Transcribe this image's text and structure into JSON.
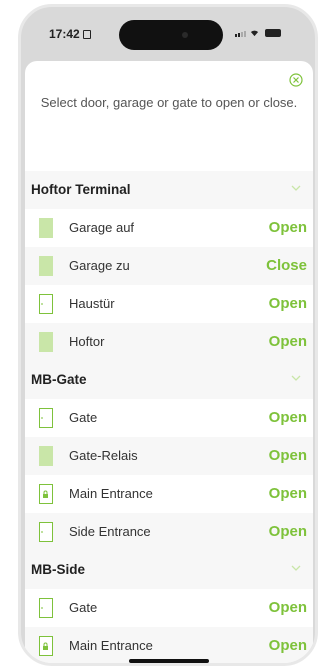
{
  "status_bar": {
    "time": "17:42"
  },
  "intro_text": "Select door, garage or gate to open or close.",
  "colors": {
    "accent": "#7ec23b",
    "icon_fill": "#c9e6a8",
    "icon_outline": "#7ec23b"
  },
  "sections": [
    {
      "title": "Hoftor Terminal",
      "items": [
        {
          "label": "Garage auf",
          "action": "Open",
          "icon": "door-filled-icon"
        },
        {
          "label": "Garage zu",
          "action": "Close",
          "icon": "door-filled-icon"
        },
        {
          "label": "Haustür",
          "action": "Open",
          "icon": "door-outline-icon"
        },
        {
          "label": "Hoftor",
          "action": "Open",
          "icon": "door-filled-icon"
        }
      ]
    },
    {
      "title": "MB-Gate",
      "items": [
        {
          "label": "Gate",
          "action": "Open",
          "icon": "door-outline-icon"
        },
        {
          "label": "Gate-Relais",
          "action": "Open",
          "icon": "door-filled-icon"
        },
        {
          "label": "Main Entrance",
          "action": "Open",
          "icon": "door-lock-icon"
        },
        {
          "label": "Side Entrance",
          "action": "Open",
          "icon": "door-outline-icon"
        }
      ]
    },
    {
      "title": "MB-Side",
      "items": [
        {
          "label": "Gate",
          "action": "Open",
          "icon": "door-outline-icon"
        },
        {
          "label": "Main Entrance",
          "action": "Open",
          "icon": "door-lock-icon"
        }
      ]
    }
  ]
}
